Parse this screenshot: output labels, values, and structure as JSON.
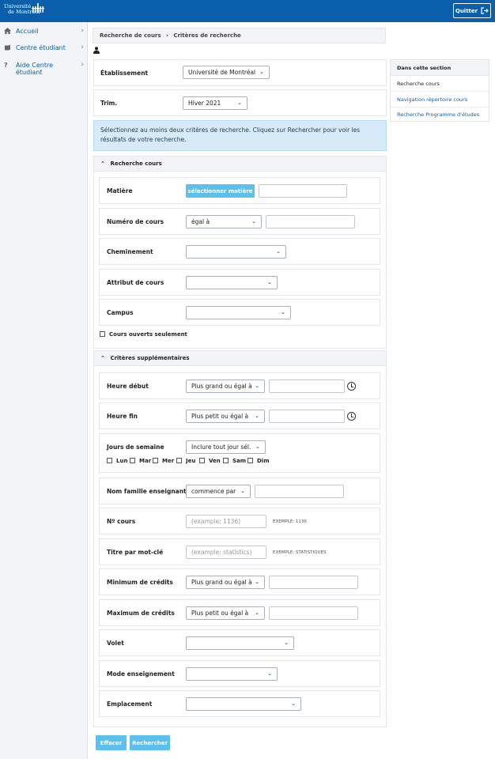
{
  "header": {
    "logo_line1": "Université",
    "logo_line2": "de Montréal",
    "quit_label": "Quitter"
  },
  "sidebar": {
    "items": [
      {
        "label": "Accueil",
        "icon": "home-icon"
      },
      {
        "label": "Centre étudiant",
        "icon": "book-icon"
      },
      {
        "label": "Aide Centre étudiant",
        "icon": "question-icon"
      }
    ]
  },
  "breadcrumb": {
    "parent": "Recherche de cours",
    "separator": "›",
    "current": "Critères de recherche"
  },
  "right_panel": {
    "title": "Dans cette section",
    "links": [
      "Recherche cours",
      "Navigation répertoire cours",
      "Recherche Programme d'études"
    ]
  },
  "form": {
    "etablissement_label": "Établissement",
    "etablissement_value": "Université de Montréal",
    "trim_label": "Trim.",
    "trim_value": "Hiver 2021",
    "info_text": "Sélectionnez au moins deux critères de recherche. Cliquez sur Rechercher pour voir les résultats de votre recherche.",
    "section1_title": "Recherche cours",
    "matiere_label": "Matière",
    "matiere_button": "sélectionner matière",
    "numero_label": "Numéro de cours",
    "numero_op": "égal à",
    "cheminement_label": "Cheminement",
    "attribut_label": "Attribut de cours",
    "campus_label": "Campus",
    "open_only_label": "Cours ouverts seulement",
    "section2_title": "Critères supplémentaires",
    "heure_debut_label": "Heure début",
    "heure_debut_op": "Plus grand ou égal à",
    "heure_fin_label": "Heure fin",
    "heure_fin_op": "Plus petit ou égal à",
    "jours_label": "Jours de semaine",
    "jours_op": "Inclure tout jour sél.",
    "days": [
      "Lun",
      "Mar",
      "Mer",
      "Jeu",
      "Ven",
      "Sam",
      "Dim"
    ],
    "nom_label": "Nom famille enseignant",
    "nom_op": "commence par",
    "no_cours_label": "Nº cours",
    "no_cours_placeholder": "(example: 1136)",
    "no_cours_example": "EXEMPLE: 1136",
    "titre_label": "Titre par mot-clé",
    "titre_placeholder": "(example: statistics)",
    "titre_example": "EXEMPLE: STATISTIQUES",
    "min_credits_label": "Minimum de crédits",
    "min_credits_op": "Plus grand ou égal à",
    "max_credits_label": "Maximum de crédits",
    "max_credits_op": "Plus petit ou égal à",
    "volet_label": "Volet",
    "mode_label": "Mode enseignement",
    "emplacement_label": "Emplacement",
    "clear_button": "Effacer",
    "search_button": "Rechercher"
  }
}
